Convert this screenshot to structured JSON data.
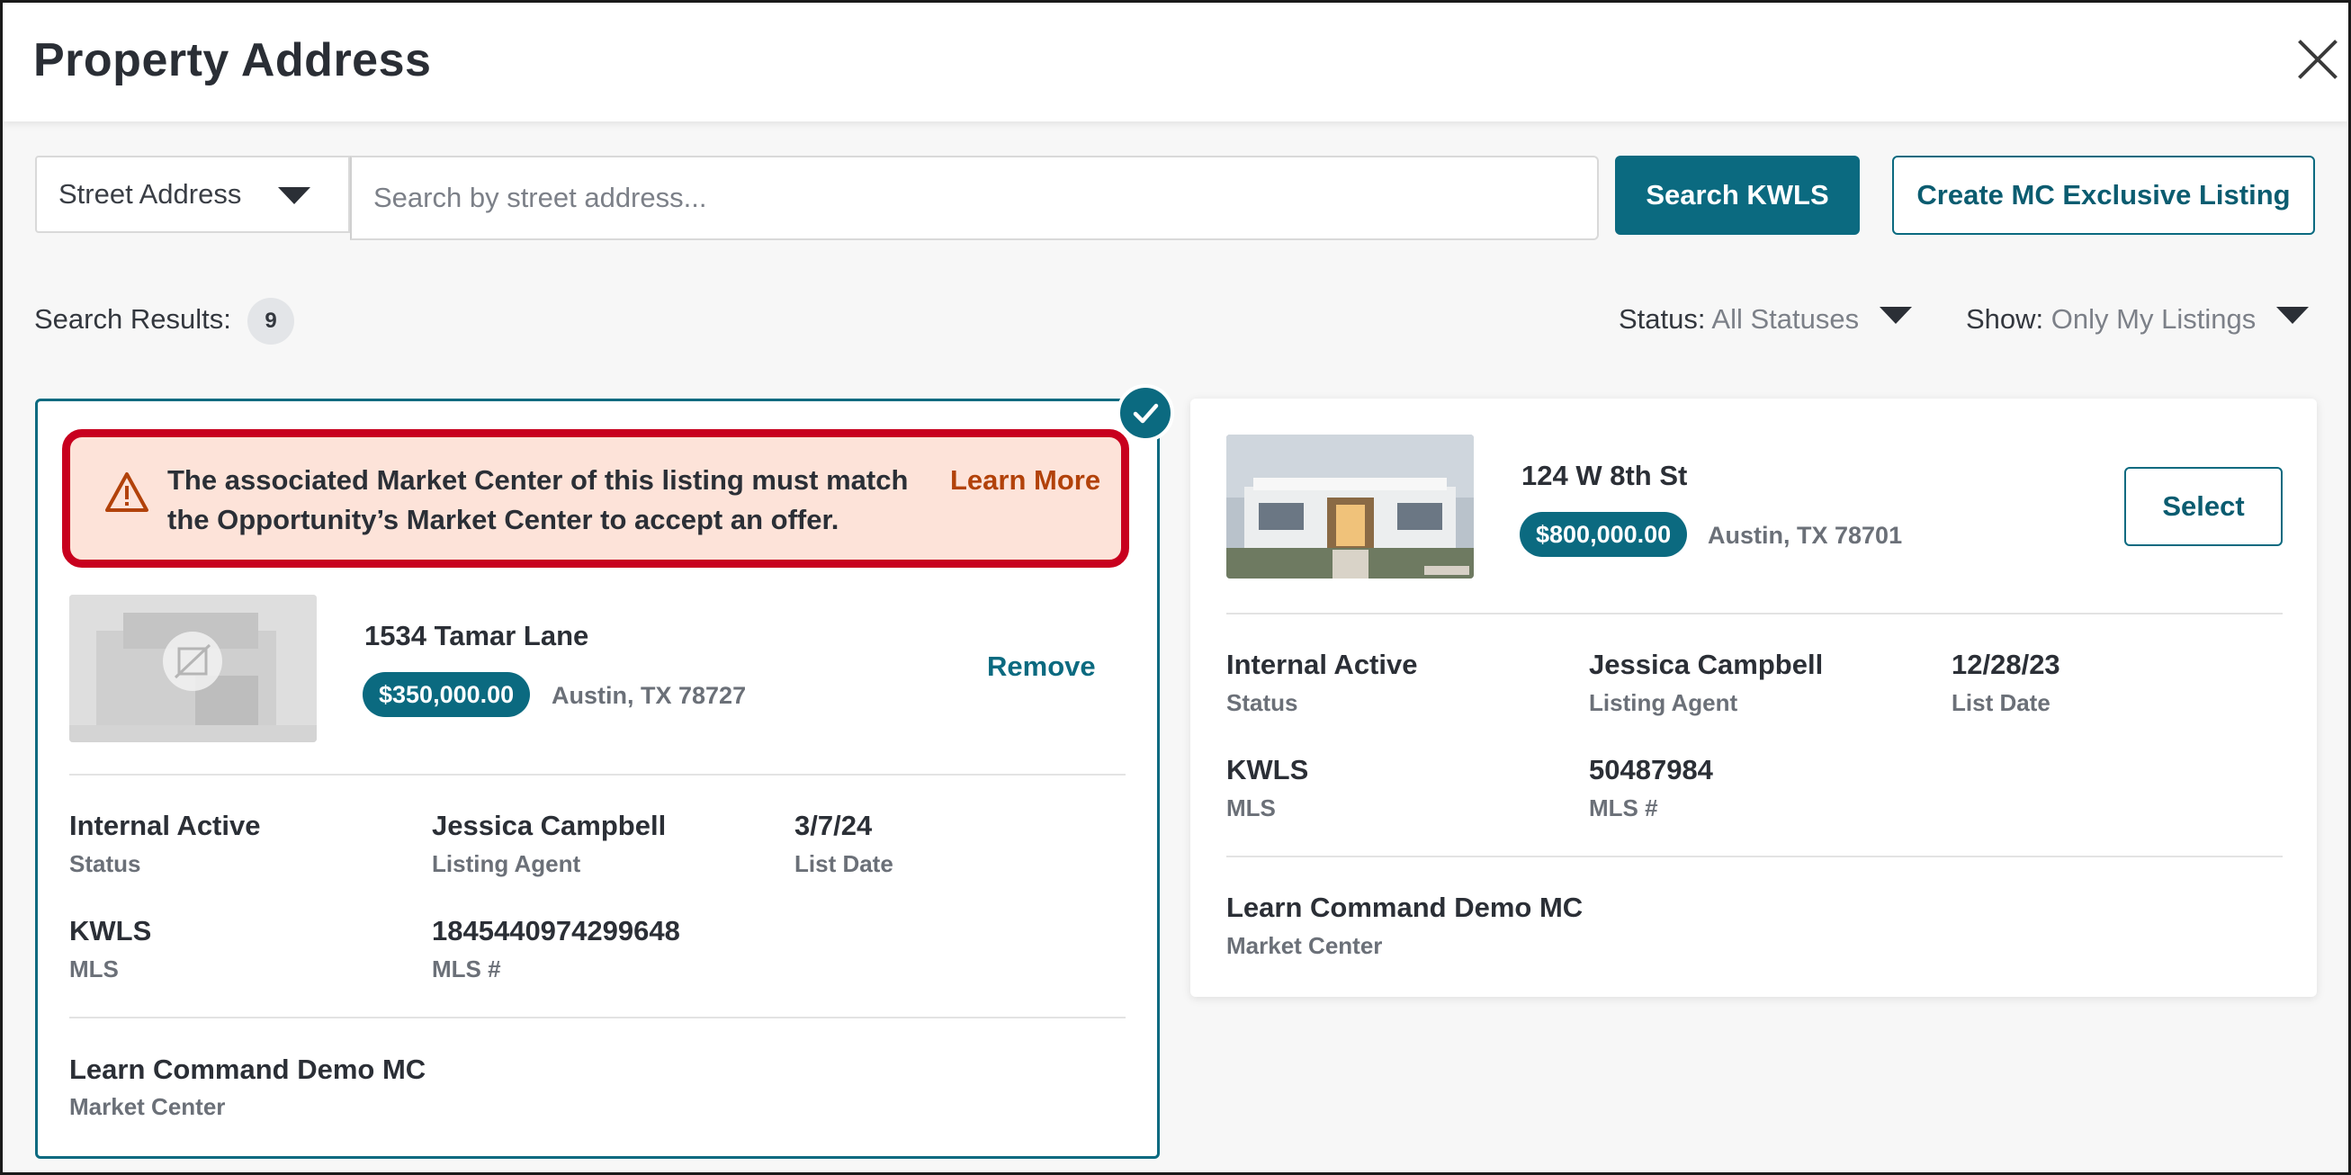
{
  "header": {
    "title": "Property Address"
  },
  "search": {
    "type_selected": "Street Address",
    "placeholder": "Search by street address...",
    "value": "",
    "search_button": "Search KWLS",
    "create_button": "Create MC Exclusive Listing"
  },
  "results": {
    "label": "Search Results:",
    "count": "9",
    "status_label": "Status:",
    "status_value": "All Statuses",
    "show_label": "Show:",
    "show_value": "Only My Listings"
  },
  "alert": {
    "message": "The associated Market Center of this listing must match the Opportunity’s Market Center to accept an offer.",
    "link": "Learn More",
    "border_color": "#c8001e",
    "background": "#fde3d9"
  },
  "listings": [
    {
      "address": "1534 Tamar Lane",
      "price": "$350,000.00",
      "city": "Austin, TX 78727",
      "action": "Remove",
      "selected": true,
      "status": "Internal Active",
      "status_label": "Status",
      "agent": "Jessica Campbell",
      "agent_label": "Listing Agent",
      "list_date": "3/7/24",
      "list_date_label": "List Date",
      "mls": "KWLS",
      "mls_label": "MLS",
      "mls_number": "1845440974299648",
      "mls_number_label": "MLS #",
      "market_center": "Learn Command Demo MC",
      "market_center_label": "Market Center"
    },
    {
      "address": "124 W 8th St",
      "price": "$800,000.00",
      "city": "Austin, TX 78701",
      "action": "Select",
      "selected": false,
      "status": "Internal Active",
      "status_label": "Status",
      "agent": "Jessica Campbell",
      "agent_label": "Listing Agent",
      "list_date": "12/28/23",
      "list_date_label": "List Date",
      "mls": "KWLS",
      "mls_label": "MLS",
      "mls_number": "50487984",
      "mls_number_label": "MLS #",
      "market_center": "Learn Command Demo MC",
      "market_center_label": "Market Center"
    }
  ],
  "colors": {
    "accent": "#0b6a80",
    "alert_link": "#b2420a"
  }
}
